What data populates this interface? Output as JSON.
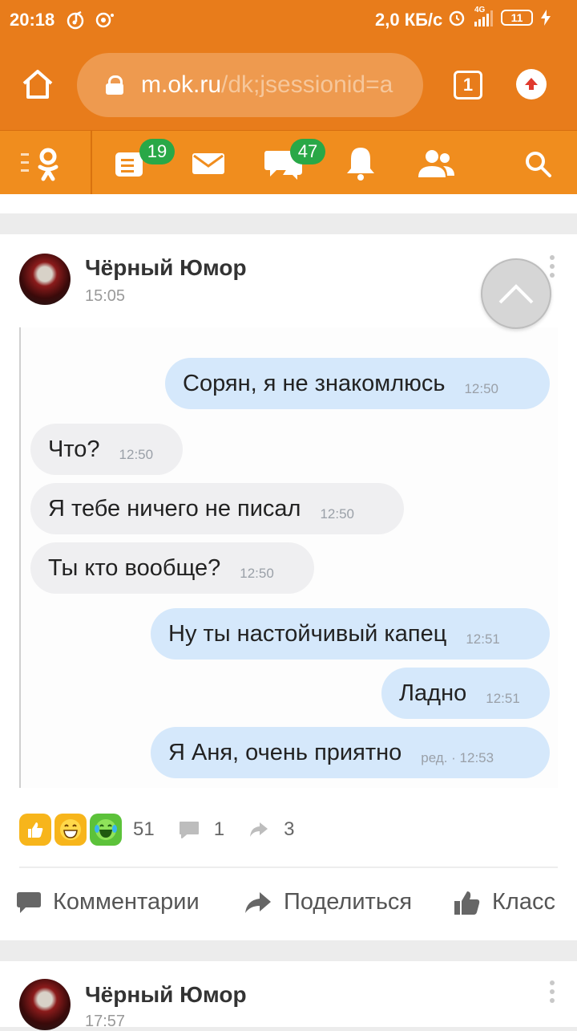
{
  "status_bar": {
    "time": "20:18",
    "speed": "2,0 КБ/с",
    "network": "4G",
    "battery": "11"
  },
  "browser": {
    "url_host": "m.ok.ru",
    "url_path": "/dk;jsessionid=a",
    "tab_count": "1"
  },
  "nav": {
    "notes_badge": "19",
    "discussions_badge": "47"
  },
  "post": {
    "author": "Чёрный Юмор",
    "time": "15:05",
    "messages": [
      {
        "text": "Сорян, я не знакомлюсь",
        "time": "12:50",
        "side": "out"
      },
      {
        "text": "Что?",
        "time": "12:50",
        "side": "in"
      },
      {
        "text": "Я тебе ничего не писал",
        "time": "12:50",
        "side": "in"
      },
      {
        "text": "Ты кто вообще?",
        "time": "12:50",
        "side": "in"
      },
      {
        "text": "Ну ты настойчивый капец",
        "time": "12:51",
        "side": "out"
      },
      {
        "text": "Ладно",
        "time": "12:51",
        "side": "out"
      },
      {
        "text": "Я Аня, очень приятно",
        "time": "ред. · 12:53",
        "side": "out"
      }
    ],
    "likes_count": "51",
    "comments_count": "1",
    "shares_count": "3",
    "actions": {
      "comments": "Комментарии",
      "share": "Поделиться",
      "like": "Класс"
    }
  },
  "post2": {
    "author": "Чёрный Юмор",
    "time": "17:57"
  }
}
